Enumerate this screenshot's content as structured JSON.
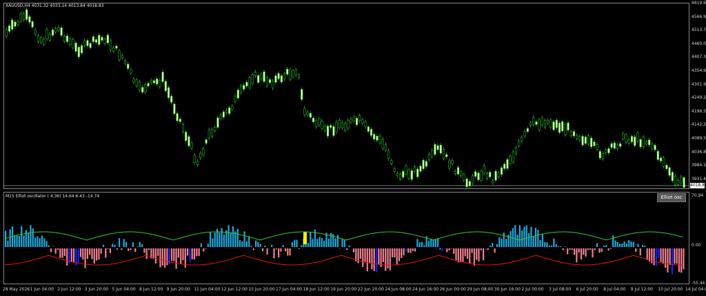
{
  "main_title": "XAUUSD,H4  4031.32 4033.14 4013.84 4018.83",
  "osc_title": "M15 Elliot oscillator ( 4,36) 14.64 6.43 -14.74",
  "osc_button": "Elliot osc",
  "current_price": "4018.83",
  "price_axis": [
    "4619.65",
    "4566.95",
    "4513.70",
    "4460.00",
    "4407.30",
    "4354.60",
    "4301.90",
    "4249.20",
    "4196.50",
    "4142.25",
    "4089.55",
    "4036.85",
    "3984.15",
    "3931.45"
  ],
  "osc_axis": [
    "70.94",
    "0.00",
    "-55.44"
  ],
  "time_axis": [
    "28 May 2026",
    "1 Jun 04:00",
    "2 Jun 12:00",
    "3 Jun 20:00",
    "5 Jun 04:00",
    "8 Jun 12:00",
    "9 Jun 20:00",
    "11 Jun 04:00",
    "12 Jun 12:00",
    "15 Jun 20:00",
    "17 Jun 04:00",
    "18 Jun 12:00",
    "19 Jun 20:00",
    "22 Jun 20:00",
    "24 Jun 08:00",
    "24 Jun 16:00",
    "26 Jun 00:00",
    "29 Jun 08:00",
    "30 Jun 16:00",
    "2 Jul 00:00",
    "3 Jul 08:00",
    "6 Jul 20:00",
    "8 Jul 04:00",
    "9 Jul 12:00",
    "10 Jul 20:00",
    "14 Jul 04:00"
  ],
  "colors": {
    "bull": "#d8ffa8",
    "bear": "#000000",
    "wick": "#33cc33",
    "osc_pos": "#22aadd",
    "osc_neg": "#f08090",
    "osc_strong": "#1122ff",
    "highlight": "#ffee00",
    "line_green": "#33cc33",
    "line_red": "#ee1111",
    "grid": "#8a8a8a"
  }
}
